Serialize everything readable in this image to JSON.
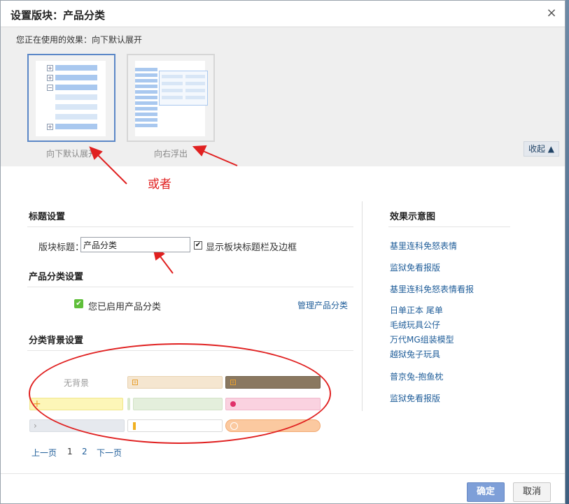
{
  "dialog": {
    "title": "设置版块：产品分类",
    "close_symbol": "×"
  },
  "effect": {
    "current_label": "您正在使用的效果：向下默认展开",
    "options": [
      {
        "label": "向下默认展开"
      },
      {
        "label": "向右浮出"
      }
    ],
    "collapse_label": "收起 ▲"
  },
  "annotation": {
    "or_text": "或者"
  },
  "title_settings": {
    "heading": "标题设置",
    "field_label": "版块标题：",
    "field_value": "产品分类",
    "checkbox_label": "显示板块标题栏及边框",
    "checkbox_mark": "✔"
  },
  "category_settings": {
    "heading": "产品分类设置",
    "enabled_mark": "✔",
    "enabled_label": "您已启用产品分类",
    "manage_link": "管理产品分类"
  },
  "background_settings": {
    "heading": "分类背景设置",
    "no_background": "无背景",
    "swatches": [
      {
        "color": "#f5e6d0",
        "accent": "#e8a030"
      },
      {
        "color": "#8a7860",
        "accent": "#e8a030"
      },
      {
        "color": "#fdf6b8",
        "accent": "#e8a030"
      },
      {
        "color": "#e4efdc",
        "accent": "#d8e8cc"
      },
      {
        "color": "#fad2e0",
        "accent": "#e0306a"
      },
      {
        "color": "#e6e9ee",
        "accent": "#999999"
      },
      {
        "color": "#ffffff",
        "accent": "#f0b020"
      },
      {
        "color": "#fbc9a0",
        "accent": "#f29a5a"
      }
    ]
  },
  "pager": {
    "prev": "上一页",
    "page1": "1",
    "page2": "2",
    "next": "下一页"
  },
  "preview": {
    "heading": "效果示意图",
    "links": [
      "基里连科免怒表情",
      "监狱免看报版",
      "基里连科免怒表情看报",
      "日单正本 尾单",
      "毛绒玩具公仔",
      "万代MG组装模型",
      "越狱兔子玩具",
      "普京兔-抱鱼枕",
      "监狱免看报版"
    ]
  },
  "buttons": {
    "ok": "确定",
    "cancel": "取消"
  },
  "colors": {
    "accent_blue": "#5b87c7",
    "link": "#1f5d99",
    "annotation_red": "#e02020"
  }
}
